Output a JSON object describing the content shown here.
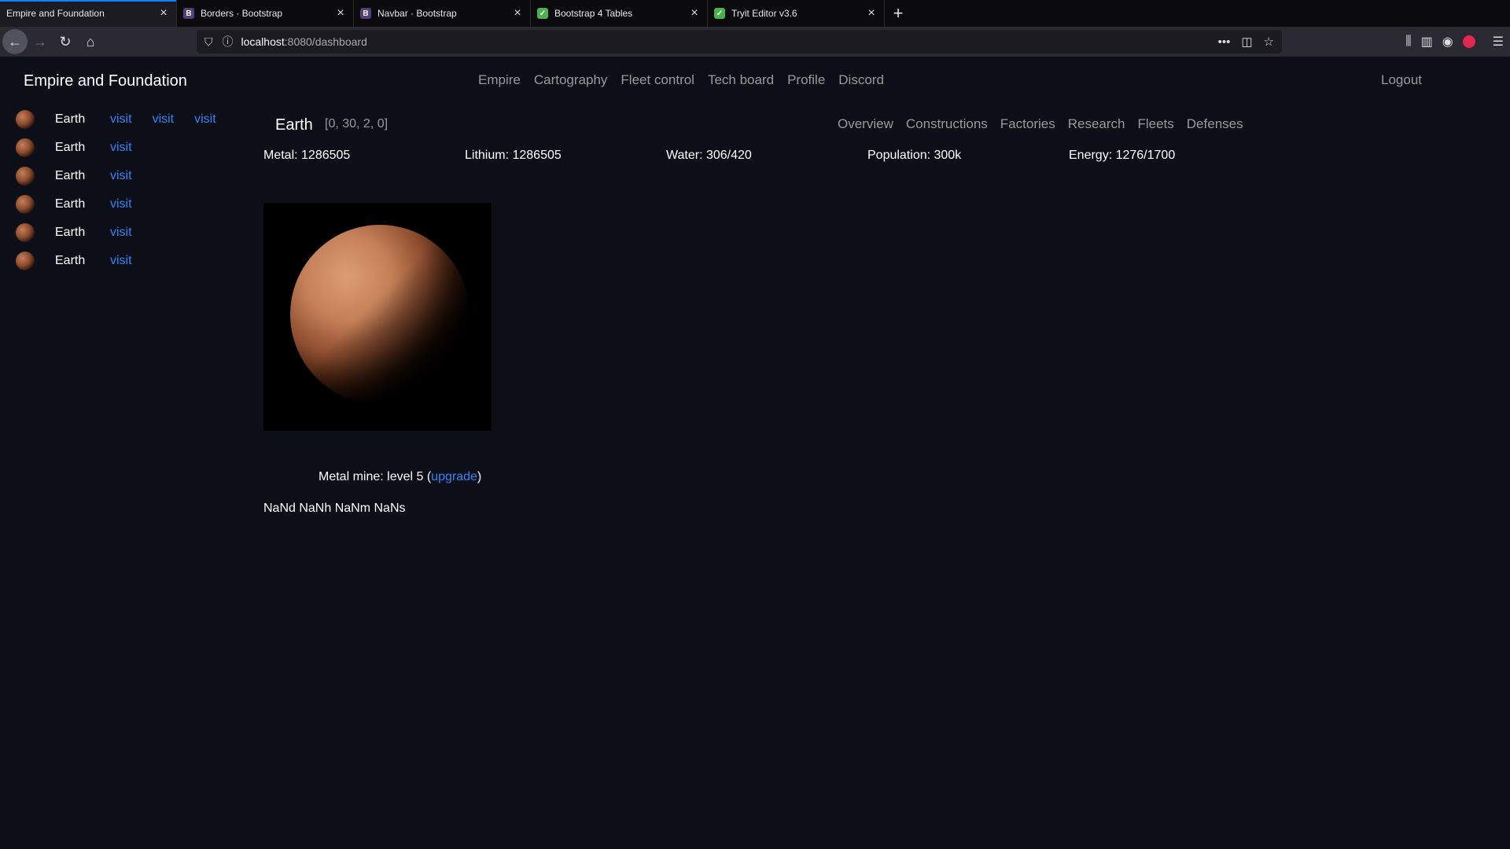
{
  "browser": {
    "tabs": [
      {
        "title": "Empire and Foundation",
        "icon": "none",
        "active": true
      },
      {
        "title": "Borders · Bootstrap",
        "icon": "B"
      },
      {
        "title": "Navbar · Bootstrap",
        "icon": "B"
      },
      {
        "title": "Bootstrap 4 Tables",
        "icon": "w3"
      },
      {
        "title": "Tryit Editor v3.6",
        "icon": "w3"
      }
    ],
    "url_host": "localhost",
    "url_path": ":8080/dashboard"
  },
  "app": {
    "brand": "Empire and Foundation",
    "nav": [
      "Empire",
      "Cartography",
      "Fleet control",
      "Tech board",
      "Profile",
      "Discord"
    ],
    "logout": "Logout"
  },
  "planets": [
    {
      "name": "Earth",
      "links": [
        "visit",
        "visit",
        "visit"
      ]
    },
    {
      "name": "Earth",
      "links": [
        "visit"
      ]
    },
    {
      "name": "Earth",
      "links": [
        "visit"
      ]
    },
    {
      "name": "Earth",
      "links": [
        "visit"
      ]
    },
    {
      "name": "Earth",
      "links": [
        "visit"
      ]
    },
    {
      "name": "Earth",
      "links": [
        "visit"
      ]
    }
  ],
  "current_planet": {
    "name": "Earth",
    "coords": "[0, 30, 2, 0]",
    "subnav": [
      "Overview",
      "Constructions",
      "Factories",
      "Research",
      "Fleets",
      "Defenses"
    ],
    "resources": {
      "metal": "Metal: 1286505",
      "lithium": "Lithium: 1286505",
      "water": "Water: 306/420",
      "population": "Population: 300k",
      "energy": "Energy: 1276/1700"
    },
    "mine_prefix": "Metal mine: level 5 (",
    "mine_link": "upgrade",
    "mine_suffix": ")",
    "timer": "NaNd NaNh NaNm NaNs"
  }
}
